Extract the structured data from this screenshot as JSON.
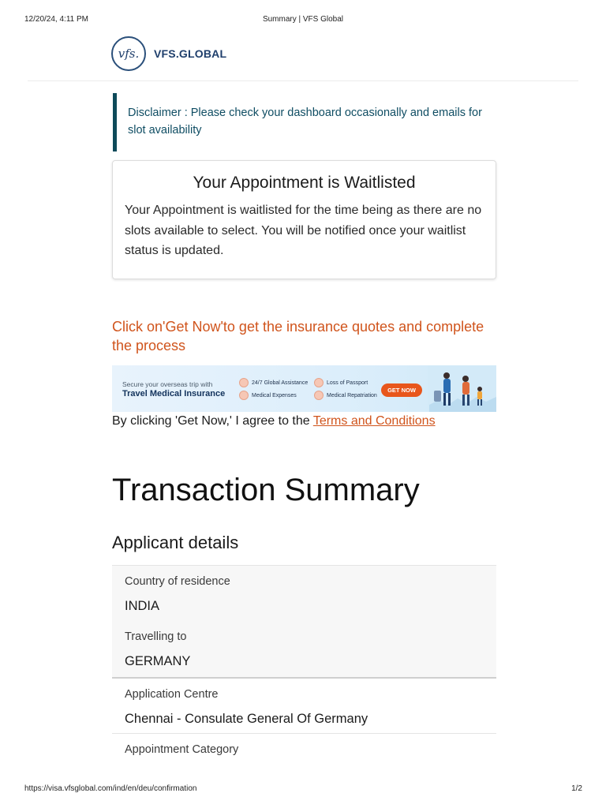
{
  "print_header": {
    "datetime": "12/20/24, 4:11 PM",
    "title": "Summary | VFS Global"
  },
  "logo": {
    "mark": "vfs.",
    "text": "VFS.GLOBAL"
  },
  "disclaimer": {
    "text": "Disclaimer : Please check your dashboard occasionally and emails for slot availability"
  },
  "waitlist": {
    "title": "Your Appointment is Waitlisted",
    "body": "Your Appointment is waitlisted for the time being as there are no slots available to select. You will be notified once your waitlist status is updated."
  },
  "insurance": {
    "cta": "Click on'Get Now'to get the insurance quotes and complete the process",
    "banner": {
      "tagline": "Secure your overseas trip with",
      "headline": "Travel Medical Insurance",
      "features": [
        "24/7 Global Assistance",
        "Loss of Passport",
        "Medical Expenses",
        "Medical Repatriation"
      ],
      "button": "GET NOW"
    },
    "terms_prefix": "By clicking 'Get Now,' I agree to the ",
    "terms_link": "Terms and Conditions"
  },
  "summary": {
    "title": "Transaction Summary",
    "section_title": "Applicant details",
    "rows": [
      {
        "label": "Country of residence",
        "value": "INDIA"
      },
      {
        "label": "Travelling to",
        "value": "GERMANY"
      },
      {
        "label": "Application Centre",
        "value": "Chennai - Consulate General Of Germany"
      },
      {
        "label": "Appointment Category",
        "value": ""
      }
    ]
  },
  "print_footer": {
    "url": "https://visa.vfsglobal.com/ind/en/deu/confirmation",
    "page": "1/2"
  },
  "colors": {
    "accent_teal": "#0e4a5a",
    "cta_orange": "#d0541c",
    "brand_navy": "#1f3f6c"
  }
}
